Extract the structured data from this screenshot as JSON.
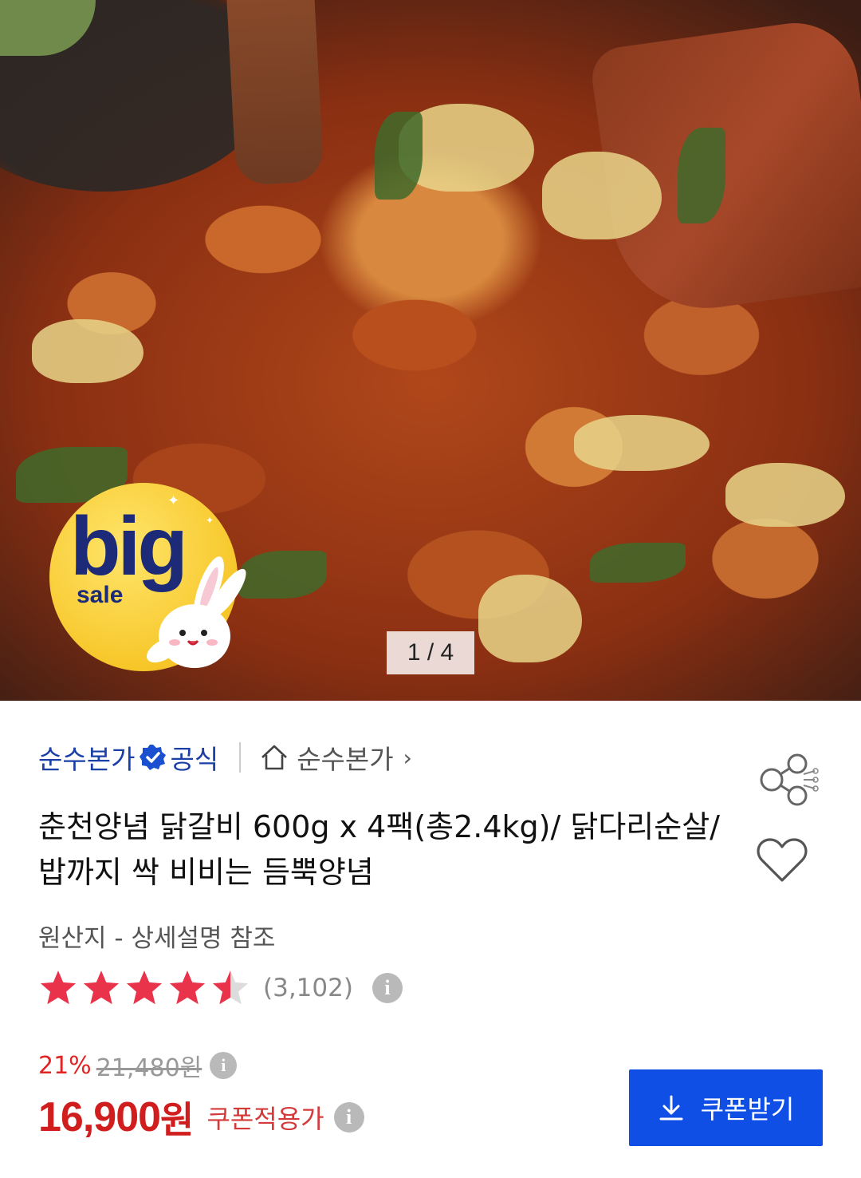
{
  "hero": {
    "counter": "1 / 4",
    "badge": {
      "big": "big",
      "sale": "sale"
    }
  },
  "seller": {
    "brand": "순수본가",
    "official": "공식",
    "store": "순수본가"
  },
  "product": {
    "title": "춘천양념 닭갈비 600g x 4팩(총2.4kg)/ 닭다리순살/ 밥까지 싹 비비는 듬뿍양념",
    "origin": "원산지 - 상세설명 참조"
  },
  "rating": {
    "stars": 4.5,
    "count": "(3,102)"
  },
  "pricing": {
    "discount": "21%",
    "original": "21,480원",
    "price": "16,900",
    "unit": "원",
    "coupon_label": "쿠폰적용가"
  },
  "coupon_button": {
    "label": "쿠폰받기"
  },
  "colors": {
    "brand_blue": "#1a3fa6",
    "button_blue": "#0f4fe6",
    "price_red": "#d01e1e",
    "star_red": "#e8334a"
  }
}
